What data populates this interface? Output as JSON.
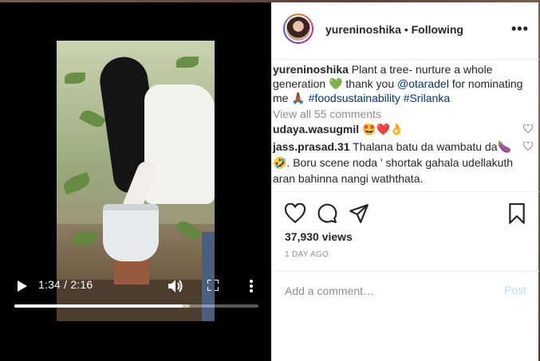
{
  "video": {
    "time_display": "1:34 / 2:16",
    "progress": 0.69,
    "buffered": 0.72
  },
  "header": {
    "username": "yureninoshika",
    "separator": "•",
    "follow_status": "Following",
    "more": "•••"
  },
  "caption": {
    "username": "yureninoshika",
    "text_1": " Plant a tree- nurture a whole generation ",
    "emoji_1": "💚",
    "text_2": " thank you ",
    "mention": "@otaradel",
    "text_3": " for nominating me ",
    "emoji_2": "🙏🏾",
    "text_4": " ",
    "hashtag_1": "#foodsustainability",
    "text_5": " ",
    "hashtag_2": "#Srilanka"
  },
  "view_all_comments": "View all 55 comments",
  "comments": [
    {
      "username": "udaya.wasugmil",
      "text": " 🤩❤️👌"
    },
    {
      "username": "jass.prasad.31",
      "text": " Thalana batu da wambatu da🍆🤣. Boru scene noda ' shortak gahala udellakuth aran bahinna nangi waththata."
    }
  ],
  "stats": {
    "views": "37,930 views",
    "time_ago": "1 DAY AGO"
  },
  "comment_box": {
    "placeholder": "Add a comment…",
    "post_label": "Post"
  },
  "colors": {
    "link": "#00376b",
    "muted": "#8e8e8e",
    "post_disabled": "#b2dffc",
    "text": "#262626"
  },
  "icons": {
    "like": "heart-icon",
    "comment": "speech-bubble-icon",
    "share": "paper-plane-icon",
    "save": "bookmark-icon"
  }
}
